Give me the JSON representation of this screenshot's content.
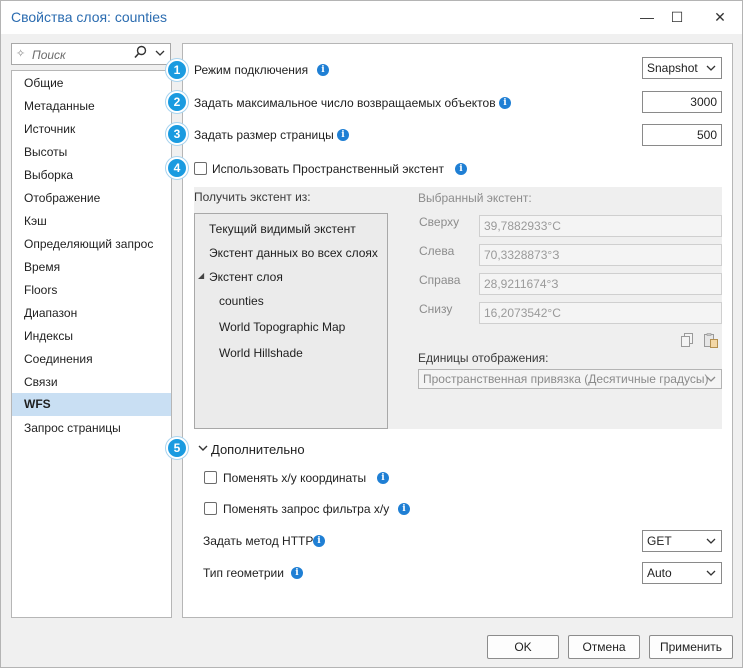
{
  "window": {
    "title": "Свойства слоя: counties",
    "minimize_glyph": "—",
    "maximize_glyph": "☐",
    "close_glyph": "✕"
  },
  "search": {
    "placeholder": "Поиск",
    "icon": "magnifier-icon"
  },
  "nav": {
    "items": [
      {
        "label": "Общие"
      },
      {
        "label": "Метаданные"
      },
      {
        "label": "Источник"
      },
      {
        "label": "Высоты"
      },
      {
        "label": "Выборка"
      },
      {
        "label": "Отображение"
      },
      {
        "label": "Кэш"
      },
      {
        "label": "Определяющий запрос"
      },
      {
        "label": "Время"
      },
      {
        "label": "Floors"
      },
      {
        "label": "Диапазон"
      },
      {
        "label": "Индексы"
      },
      {
        "label": "Соединения"
      },
      {
        "label": "Связи"
      },
      {
        "label": "WFS"
      },
      {
        "label": "Запрос страницы"
      }
    ],
    "selected": "WFS"
  },
  "badges": [
    "1",
    "2",
    "3",
    "4",
    "5"
  ],
  "settings": {
    "connection_mode": {
      "label": "Режим подключения",
      "value": "Snapshot"
    },
    "max_features": {
      "label": "Задать максимальное число возвращаемых объектов",
      "value": "3000"
    },
    "page_size": {
      "label": "Задать размер страницы",
      "value": "500"
    },
    "use_spatial_extent": {
      "label": "Использовать Пространственный экстент",
      "checked": false
    }
  },
  "extent": {
    "get_from_label": "Получить экстент из:",
    "selected_label": "Выбранный экстент:",
    "sources": [
      {
        "label": "Текущий видимый экстент"
      },
      {
        "label": "Экстент данных во всех слоях"
      },
      {
        "label": "Экстент слоя",
        "expanded": true
      },
      {
        "label": "counties"
      },
      {
        "label": "World Topographic Map"
      },
      {
        "label": "World Hillshade"
      }
    ],
    "expand_glyph": "◢",
    "top": {
      "label": "Сверху",
      "value": "39,7882933°С"
    },
    "left": {
      "label": "Слева",
      "value": "70,3328873°З"
    },
    "right": {
      "label": "Справа",
      "value": "28,9211674°З"
    },
    "bottom": {
      "label": "Снизу",
      "value": "16,2073542°С"
    },
    "units_label": "Единицы отображения:",
    "units_value": "Пространственная привязка (Десятичные градусы)"
  },
  "advanced": {
    "header": "Дополнительно",
    "swap_xy": {
      "label": "Поменять x/y координаты",
      "checked": false
    },
    "swap_filter_xy": {
      "label": "Поменять запрос фильтра x/y",
      "checked": false
    },
    "http_method": {
      "label": "Задать метод HTTP",
      "value": "GET"
    },
    "geometry_type": {
      "label": "Тип геометрии",
      "value": "Auto"
    }
  },
  "buttons": {
    "ok": "OK",
    "cancel": "Отмена",
    "apply": "Применить"
  },
  "colors": {
    "accent": "#1a9be0",
    "selection": "#c9dff3",
    "title": "#2b6cb0",
    "info": "#1f7fd4"
  }
}
